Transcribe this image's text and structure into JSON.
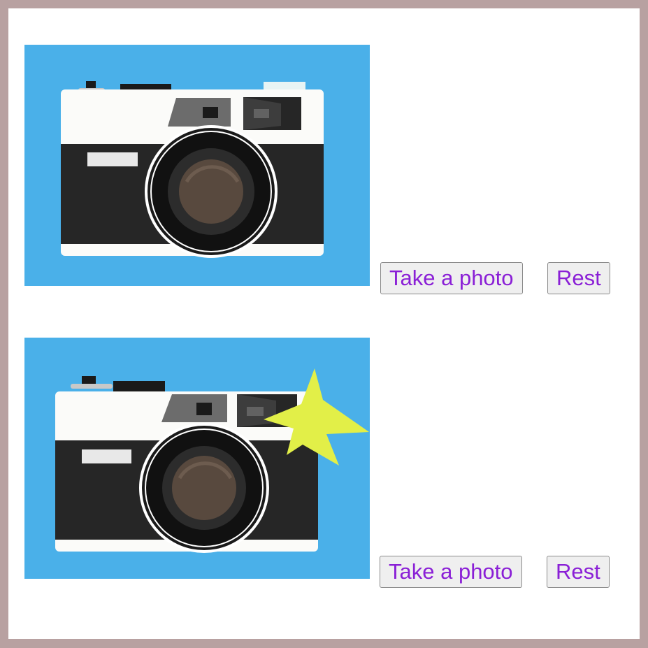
{
  "colors": {
    "sky": "#4ab0e9",
    "body_white": "#fbfbf9",
    "body_black": "#262626",
    "lens_brown": "#58493e",
    "flash_burst": "#e2ef48",
    "button_text": "#8a1fd6"
  },
  "panels": [
    {
      "flash_visible": false,
      "take_photo_label": "Take a photo",
      "rest_label": "Rest"
    },
    {
      "flash_visible": true,
      "take_photo_label": "Take a photo",
      "rest_label": "Rest"
    }
  ]
}
